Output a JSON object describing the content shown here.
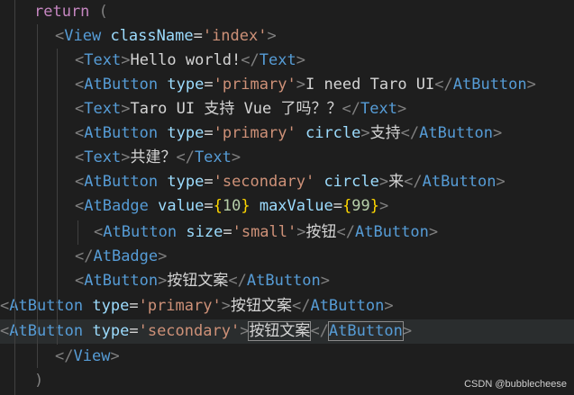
{
  "editor": {
    "lines": [
      [
        {
          "t": "return ",
          "c": "kw"
        },
        {
          "t": "(",
          "c": "punct"
        }
      ],
      [
        {
          "t": "<",
          "c": "punct"
        },
        {
          "t": "View",
          "c": "tag"
        },
        {
          "t": " ",
          "c": "txt"
        },
        {
          "t": "className",
          "c": "attr"
        },
        {
          "t": "=",
          "c": "txt"
        },
        {
          "t": "'index'",
          "c": "str"
        },
        {
          "t": ">",
          "c": "punct"
        }
      ],
      [
        {
          "t": "<",
          "c": "punct"
        },
        {
          "t": "Text",
          "c": "tag"
        },
        {
          "t": ">",
          "c": "punct"
        },
        {
          "t": "Hello world!",
          "c": "txt"
        },
        {
          "t": "</",
          "c": "punct"
        },
        {
          "t": "Text",
          "c": "tag"
        },
        {
          "t": ">",
          "c": "punct"
        }
      ],
      [
        {
          "t": "<",
          "c": "punct"
        },
        {
          "t": "AtButton",
          "c": "tag"
        },
        {
          "t": " ",
          "c": "txt"
        },
        {
          "t": "type",
          "c": "attr"
        },
        {
          "t": "=",
          "c": "txt"
        },
        {
          "t": "'primary'",
          "c": "str"
        },
        {
          "t": ">",
          "c": "punct"
        },
        {
          "t": "I need Taro UI",
          "c": "txt"
        },
        {
          "t": "</",
          "c": "punct"
        },
        {
          "t": "AtButton",
          "c": "tag"
        },
        {
          "t": ">",
          "c": "punct"
        }
      ],
      [
        {
          "t": "<",
          "c": "punct"
        },
        {
          "t": "Text",
          "c": "tag"
        },
        {
          "t": ">",
          "c": "punct"
        },
        {
          "t": "Taro UI 支持 Vue 了吗？？",
          "c": "txt"
        },
        {
          "t": "</",
          "c": "punct"
        },
        {
          "t": "Text",
          "c": "tag"
        },
        {
          "t": ">",
          "c": "punct"
        }
      ],
      [
        {
          "t": "<",
          "c": "punct"
        },
        {
          "t": "AtButton",
          "c": "tag"
        },
        {
          "t": " ",
          "c": "txt"
        },
        {
          "t": "type",
          "c": "attr"
        },
        {
          "t": "=",
          "c": "txt"
        },
        {
          "t": "'primary'",
          "c": "str"
        },
        {
          "t": " ",
          "c": "txt"
        },
        {
          "t": "circle",
          "c": "attr"
        },
        {
          "t": ">",
          "c": "punct"
        },
        {
          "t": "支持",
          "c": "txt"
        },
        {
          "t": "</",
          "c": "punct"
        },
        {
          "t": "AtButton",
          "c": "tag"
        },
        {
          "t": ">",
          "c": "punct"
        }
      ],
      [
        {
          "t": "<",
          "c": "punct"
        },
        {
          "t": "Text",
          "c": "tag"
        },
        {
          "t": ">",
          "c": "punct"
        },
        {
          "t": "共建？",
          "c": "txt"
        },
        {
          "t": "</",
          "c": "punct"
        },
        {
          "t": "Text",
          "c": "tag"
        },
        {
          "t": ">",
          "c": "punct"
        }
      ],
      [
        {
          "t": "<",
          "c": "punct"
        },
        {
          "t": "AtButton",
          "c": "tag"
        },
        {
          "t": " ",
          "c": "txt"
        },
        {
          "t": "type",
          "c": "attr"
        },
        {
          "t": "=",
          "c": "txt"
        },
        {
          "t": "'secondary'",
          "c": "str"
        },
        {
          "t": " ",
          "c": "txt"
        },
        {
          "t": "circle",
          "c": "attr"
        },
        {
          "t": ">",
          "c": "punct"
        },
        {
          "t": "来",
          "c": "txt"
        },
        {
          "t": "</",
          "c": "punct"
        },
        {
          "t": "AtButton",
          "c": "tag"
        },
        {
          "t": ">",
          "c": "punct"
        }
      ],
      [
        {
          "t": "<",
          "c": "punct"
        },
        {
          "t": "AtBadge",
          "c": "tag"
        },
        {
          "t": " ",
          "c": "txt"
        },
        {
          "t": "value",
          "c": "attr"
        },
        {
          "t": "=",
          "c": "txt"
        },
        {
          "t": "{",
          "c": "brace"
        },
        {
          "t": "10",
          "c": "num"
        },
        {
          "t": "}",
          "c": "brace"
        },
        {
          "t": " ",
          "c": "txt"
        },
        {
          "t": "maxValue",
          "c": "attr"
        },
        {
          "t": "=",
          "c": "txt"
        },
        {
          "t": "{",
          "c": "brace"
        },
        {
          "t": "99",
          "c": "num"
        },
        {
          "t": "}",
          "c": "brace"
        },
        {
          "t": ">",
          "c": "punct"
        }
      ],
      [
        {
          "t": "<",
          "c": "punct"
        },
        {
          "t": "AtButton",
          "c": "tag"
        },
        {
          "t": " ",
          "c": "txt"
        },
        {
          "t": "size",
          "c": "attr"
        },
        {
          "t": "=",
          "c": "txt"
        },
        {
          "t": "'small'",
          "c": "str"
        },
        {
          "t": ">",
          "c": "punct"
        },
        {
          "t": "按钮",
          "c": "txt"
        },
        {
          "t": "</",
          "c": "punct"
        },
        {
          "t": "AtButton",
          "c": "tag"
        },
        {
          "t": ">",
          "c": "punct"
        }
      ],
      [
        {
          "t": "</",
          "c": "punct"
        },
        {
          "t": "AtBadge",
          "c": "tag"
        },
        {
          "t": ">",
          "c": "punct"
        }
      ],
      [
        {
          "t": "<",
          "c": "punct"
        },
        {
          "t": "AtButton",
          "c": "tag"
        },
        {
          "t": ">",
          "c": "punct"
        },
        {
          "t": "按钮文案",
          "c": "txt"
        },
        {
          "t": "</",
          "c": "punct"
        },
        {
          "t": "AtButton",
          "c": "tag"
        },
        {
          "t": ">",
          "c": "punct"
        }
      ],
      [
        {
          "t": "<",
          "c": "punct"
        },
        {
          "t": "AtButton",
          "c": "tag"
        },
        {
          "t": " ",
          "c": "txt"
        },
        {
          "t": "type",
          "c": "attr"
        },
        {
          "t": "=",
          "c": "txt"
        },
        {
          "t": "'primary'",
          "c": "str"
        },
        {
          "t": ">",
          "c": "punct"
        },
        {
          "t": "按钮文案",
          "c": "txt"
        },
        {
          "t": "</",
          "c": "punct"
        },
        {
          "t": "AtButton",
          "c": "tag"
        },
        {
          "t": ">",
          "c": "punct"
        }
      ],
      [
        {
          "t": "<",
          "c": "punct"
        },
        {
          "t": "AtButton",
          "c": "tag"
        },
        {
          "t": " ",
          "c": "txt"
        },
        {
          "t": "type",
          "c": "attr"
        },
        {
          "t": "=",
          "c": "txt"
        },
        {
          "t": "'secondary'",
          "c": "str"
        },
        {
          "t": ">",
          "c": "punct"
        },
        {
          "t": "按钮文案",
          "c": "txt"
        },
        {
          "t": "</",
          "c": "punct"
        },
        {
          "t": "AtButton",
          "c": "tag"
        },
        {
          "t": ">",
          "c": "punct"
        }
      ],
      [
        {
          "t": "</",
          "c": "punct"
        },
        {
          "t": "View",
          "c": "tag"
        },
        {
          "t": ">",
          "c": "punct"
        }
      ],
      [
        {
          "t": ")",
          "c": "punct"
        }
      ]
    ]
  },
  "watermark": "CSDN @bubblecheese"
}
